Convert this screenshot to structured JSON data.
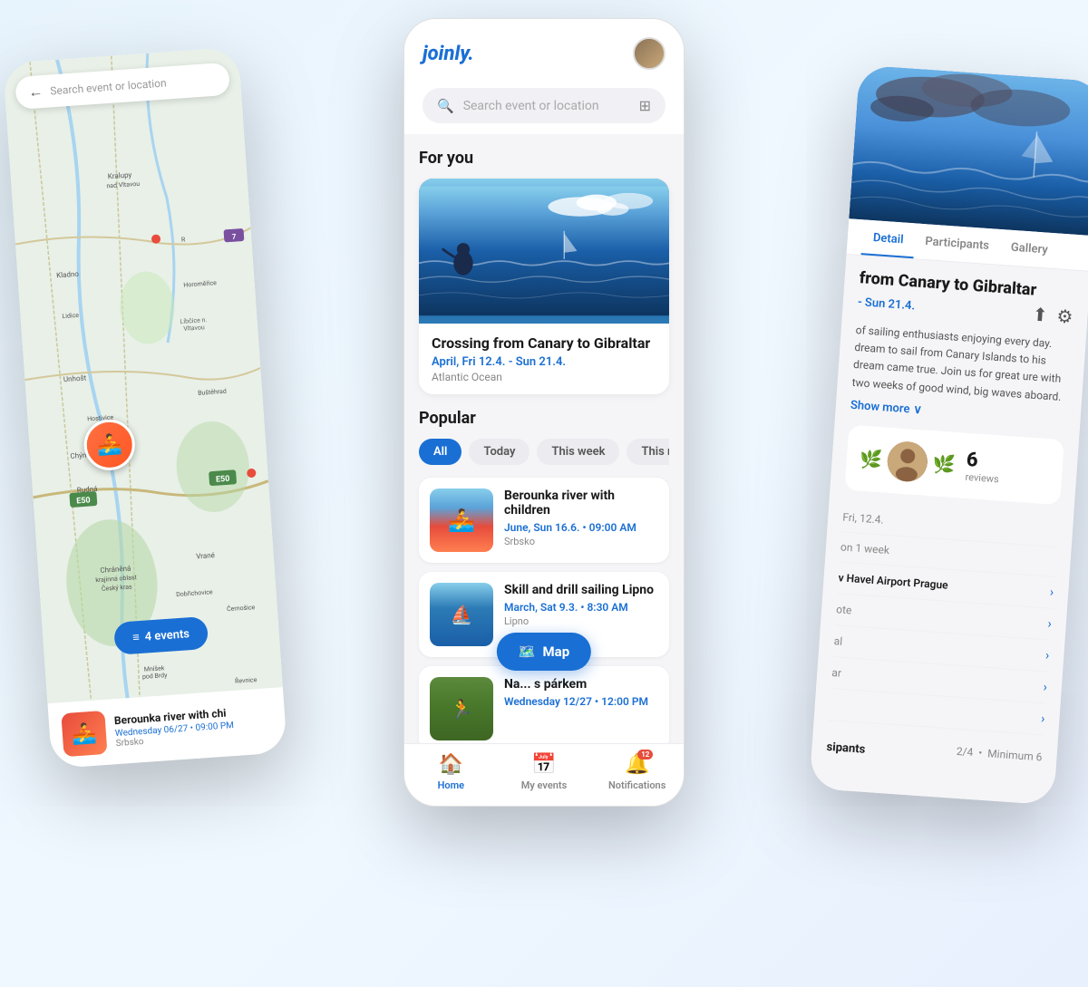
{
  "app": {
    "name": "joinly.",
    "logo": "joinly."
  },
  "left_phone": {
    "search_placeholder": "Search event or location",
    "events_count": "4 events",
    "bottom_event": {
      "title": "Berounka river with chi",
      "date": "Wednesday 06/27 • 09:00 PM",
      "location": "Srbsko"
    }
  },
  "center_phone": {
    "search": {
      "placeholder": "Search event or location",
      "filter_icon": "⊞"
    },
    "sections": {
      "for_you": "For you",
      "popular": "Popular"
    },
    "featured_event": {
      "title": "Crossing from Canary to Gibraltar",
      "date": "April, Fri 12.4. - Sun 21.4.",
      "location": "Atlantic Ocean"
    },
    "filter_tabs": [
      {
        "label": "All",
        "active": true
      },
      {
        "label": "Today",
        "active": false
      },
      {
        "label": "This week",
        "active": false
      },
      {
        "label": "This month",
        "active": false
      }
    ],
    "events": [
      {
        "title": "Berounka river with children",
        "date": "June, Sun 16.6. • 09:00 AM",
        "location": "Srbsko"
      },
      {
        "title": "Skill and drill sailing Lipno",
        "date": "March, Sat 9.3. • 8:30 AM",
        "location": "Lipno"
      },
      {
        "title": "Na... s párkem",
        "date": "Wednesday 12/27 • 12:00 PM",
        "location": ""
      }
    ],
    "map_button": "Map",
    "nav": {
      "home": "Home",
      "my_events": "My events",
      "notifications": "Notifications",
      "notification_count": "12"
    }
  },
  "right_phone": {
    "tabs": [
      "Detail",
      "Participants",
      "Gallery"
    ],
    "event": {
      "title": "from Canary to Gibraltar",
      "date": "- Sun 21.4.",
      "description": "of sailing enthusiasts enjoying every day. dream to sail from Canary Islands to his dream came true. Join us for great ure with two weeks of good wind, big waves aboard.",
      "show_more": "Show more",
      "reviews": {
        "count": "6",
        "label": "reviews"
      }
    },
    "info_rows": [
      {
        "label": "Fri, 12.4.",
        "value": ""
      },
      {
        "label": "on 1 week",
        "value": ""
      },
      {
        "label": "v Havel Airport Prague",
        "value": "›"
      },
      {
        "label": "ote",
        "value": "›"
      },
      {
        "label": "al",
        "value": "›"
      },
      {
        "label": "ar",
        "value": "›"
      },
      {
        "label": ">",
        "value": "›"
      }
    ],
    "participants": {
      "label": "sipants",
      "count": "2/4",
      "minimum": "Minimum 6"
    }
  }
}
